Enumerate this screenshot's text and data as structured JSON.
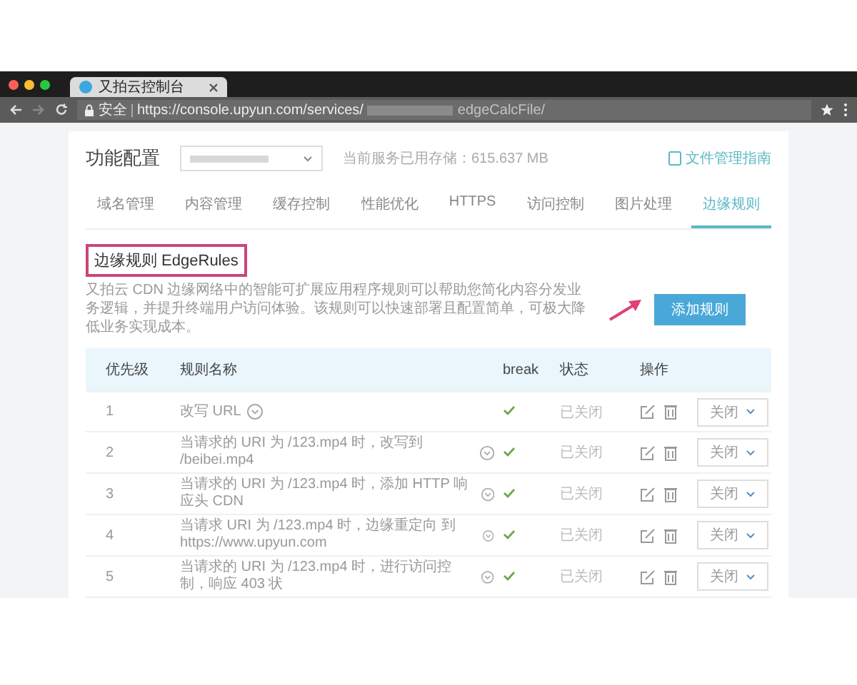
{
  "browser": {
    "tab_title": "又拍云控制台",
    "security_label": "安全",
    "url_start": "https://console.upyun.com/services/",
    "url_end": "edgeCalcFile/"
  },
  "header": {
    "title": "功能配置",
    "storage": "当前服务已用存储：615.637 MB",
    "guide_link": "文件管理指南"
  },
  "tabs": [
    {
      "label": "域名管理",
      "selected": false
    },
    {
      "label": "内容管理",
      "selected": false
    },
    {
      "label": "缓存控制",
      "selected": false
    },
    {
      "label": "性能优化",
      "selected": false
    },
    {
      "label": "HTTPS",
      "selected": false
    },
    {
      "label": "访问控制",
      "selected": false
    },
    {
      "label": "图片处理",
      "selected": false
    },
    {
      "label": "边缘规则",
      "selected": true
    }
  ],
  "section": {
    "heading": "边缘规则 EdgeRules",
    "description": "又拍云 CDN 边缘网络中的智能可扩展应用程序规则可以帮助您简化内容分发业务逻辑，并提升终端用户访问体验。该规则可以快速部署且配置简单，可极大降低业务实现成本。",
    "add_button": "添加规则"
  },
  "table": {
    "columns": [
      "优先级",
      "规则名称",
      "break",
      "状态",
      "操作"
    ],
    "rows": [
      {
        "priority": "1",
        "name": "改写 URL",
        "break": true,
        "status": "已关闭",
        "toggle": "关闭"
      },
      {
        "priority": "2",
        "name": "当请求的 URI 为 /123.mp4 时，改写到 /beibei.mp4",
        "break": true,
        "status": "已关闭",
        "toggle": "关闭"
      },
      {
        "priority": "3",
        "name": "当请求的 URI 为 /123.mp4 时，添加 HTTP 响应头 CDN",
        "break": true,
        "status": "已关闭",
        "toggle": "关闭"
      },
      {
        "priority": "4",
        "name": "当请求 URI 为 /123.mp4 时，边缘重定向 到 https://www.upyun.com",
        "break": true,
        "status": "已关闭",
        "toggle": "关闭"
      },
      {
        "priority": "5",
        "name": "当请求的 URI 为 /123.mp4 时，进行访问控制，响应 403 状",
        "break": true,
        "status": "已关闭",
        "toggle": "关闭"
      }
    ]
  }
}
